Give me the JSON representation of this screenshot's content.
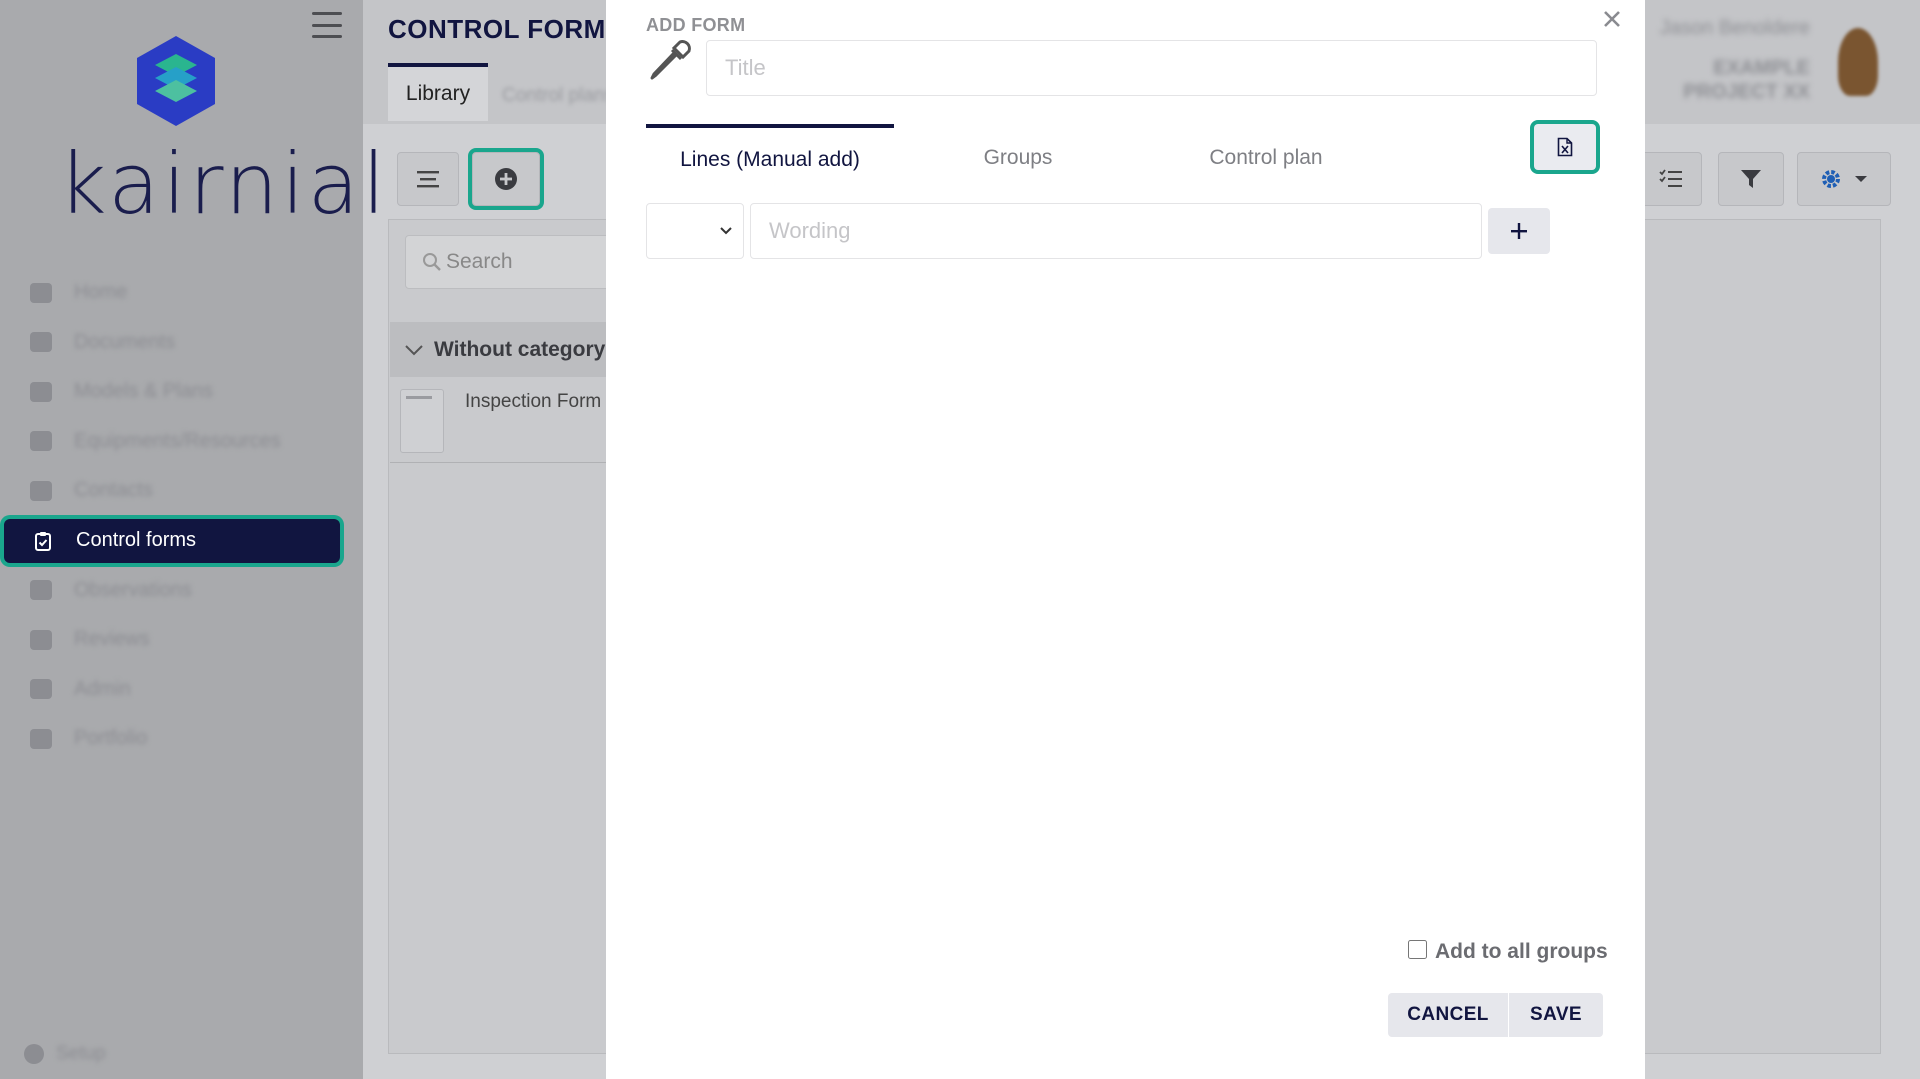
{
  "app": {
    "brand": "kairnial",
    "accent_color": "#1aa68d",
    "navy_color": "#111540"
  },
  "sidebar": {
    "items": [
      {
        "label": "Home",
        "icon": "home-icon",
        "active": false
      },
      {
        "label": "Documents",
        "icon": "document-icon",
        "active": false
      },
      {
        "label": "Models & Plans",
        "icon": "monitor-icon",
        "active": false
      },
      {
        "label": "Equipments/Resources",
        "icon": "equipment-icon",
        "active": false
      },
      {
        "label": "Contacts",
        "icon": "contacts-icon",
        "active": false
      },
      {
        "label": "Control forms",
        "icon": "clipboard-check-icon",
        "active": true
      },
      {
        "label": "Observations",
        "icon": "observation-icon",
        "active": false
      },
      {
        "label": "Reviews",
        "icon": "review-icon",
        "active": false
      },
      {
        "label": "Admin",
        "icon": "admin-icon",
        "active": false
      },
      {
        "label": "Portfolio",
        "icon": "portfolio-icon",
        "active": false
      }
    ],
    "setup_label": "Setup"
  },
  "header": {
    "title": "CONTROL FORMS",
    "tabs": [
      "Library",
      "Control plans"
    ],
    "user_name": "Jason Benoldere",
    "project_name": "EXAMPLE PROJECT XX"
  },
  "library": {
    "search_placeholder": "Search",
    "category": "Without category",
    "forms": [
      "Inspection Form"
    ]
  },
  "modal": {
    "title": "ADD FORM",
    "title_placeholder": "Title",
    "tabs": [
      "Lines (Manual add)",
      "Groups",
      "Control plan"
    ],
    "wording_placeholder": "Wording",
    "add_to_all_groups_label": "Add to all groups",
    "cancel_label": "CANCEL",
    "save_label": "SAVE"
  }
}
